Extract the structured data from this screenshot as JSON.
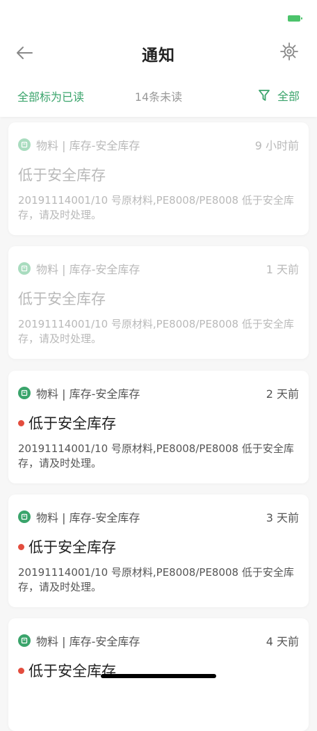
{
  "nav": {
    "title": "通知"
  },
  "toolbar": {
    "mark_all_read": "全部标为已读",
    "unread_count": "14条未读",
    "filter_label": "全部"
  },
  "colors": {
    "accent": "#3aa46b",
    "unread_dot": "#e34d3e",
    "read_text": "#b9b9b9"
  },
  "notifications": [
    {
      "category": "物料 | 库存-安全库存",
      "time": "9 小时前",
      "title": "低于安全库存",
      "body": "20191114001/10 号原材料,PE8008/PE8008 低于安全库存，请及时处理。",
      "read": true
    },
    {
      "category": "物料 | 库存-安全库存",
      "time": "1 天前",
      "title": "低于安全库存",
      "body": "20191114001/10 号原材料,PE8008/PE8008 低于安全库存，请及时处理。",
      "read": true
    },
    {
      "category": "物料 | 库存-安全库存",
      "time": "2 天前",
      "title": "低于安全库存",
      "body": "20191114001/10 号原材料,PE8008/PE8008 低于安全库存，请及时处理。",
      "read": false
    },
    {
      "category": "物料 | 库存-安全库存",
      "time": "3 天前",
      "title": "低于安全库存",
      "body": "20191114001/10 号原材料,PE8008/PE8008 低于安全库存，请及时处理。",
      "read": false
    },
    {
      "category": "物料 | 库存-安全库存",
      "time": "4 天前",
      "title": "低于安全库存",
      "body": "",
      "read": false
    }
  ]
}
